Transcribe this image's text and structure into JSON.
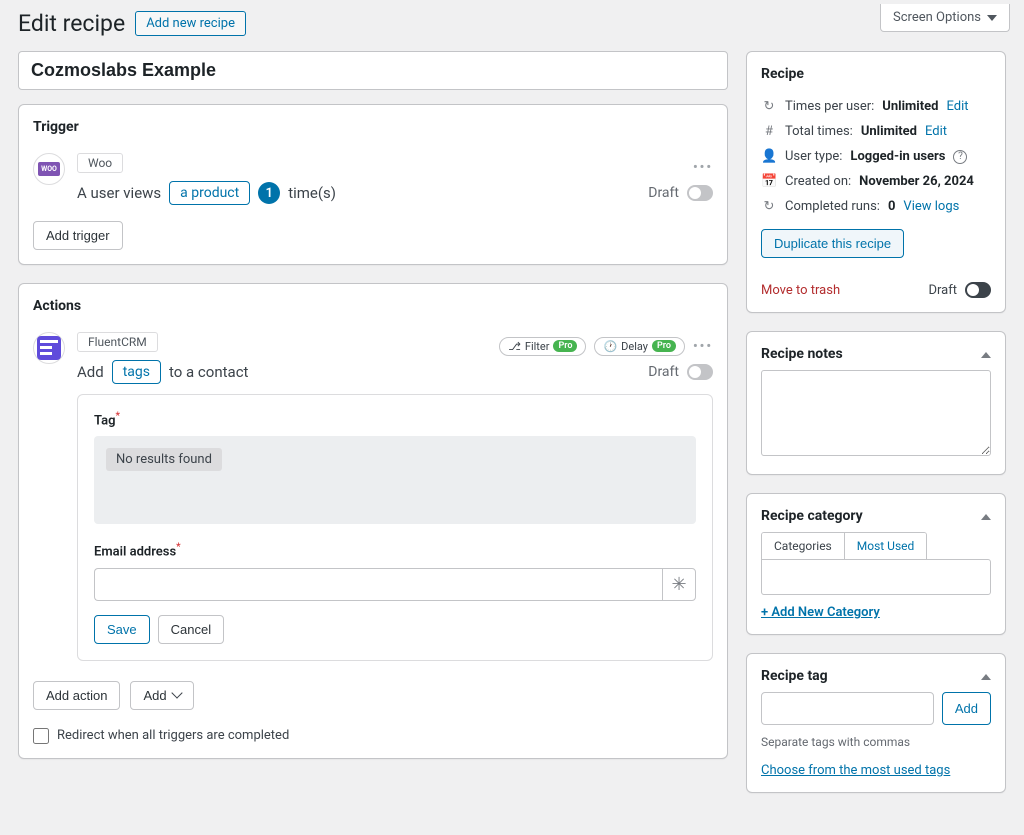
{
  "screen_options": "Screen Options",
  "page": {
    "title": "Edit recipe",
    "add_new": "Add new recipe"
  },
  "recipe": {
    "title": "Cozmoslabs Example"
  },
  "trigger_box": {
    "heading": "Trigger",
    "integration": "Woo",
    "sentence_pre": "A user views",
    "token": "a product",
    "count": "1",
    "sentence_post": "time(s)",
    "status": "Draft",
    "add_btn": "Add trigger"
  },
  "actions_box": {
    "heading": "Actions",
    "integration": "FluentCRM",
    "filter_label": "Filter",
    "delay_label": "Delay",
    "pro": "Pro",
    "sentence_pre": "Add",
    "token": "tags",
    "sentence_post": "to a contact",
    "status": "Draft",
    "form": {
      "tag_label": "Tag",
      "tag_no_results": "No results found",
      "email_label": "Email address",
      "save": "Save",
      "cancel": "Cancel"
    },
    "add_action": "Add action",
    "add": "Add",
    "redirect": "Redirect when all triggers are completed"
  },
  "sidebar": {
    "recipe": {
      "heading": "Recipe",
      "times_per_user_label": "Times per user:",
      "times_per_user_value": "Unlimited",
      "total_times_label": "Total times:",
      "total_times_value": "Unlimited",
      "user_type_label": "User type:",
      "user_type_value": "Logged-in users",
      "created_label": "Created on:",
      "created_value": "November 26, 2024",
      "completed_label": "Completed runs:",
      "completed_value": "0",
      "edit": "Edit",
      "view_logs": "View logs",
      "duplicate": "Duplicate this recipe",
      "trash": "Move to trash",
      "status": "Draft"
    },
    "notes": {
      "heading": "Recipe notes"
    },
    "category": {
      "heading": "Recipe category",
      "tab_cat": "Categories",
      "tab_most": "Most Used",
      "add_new": "+ Add New Category"
    },
    "tag": {
      "heading": "Recipe tag",
      "add": "Add",
      "helper": "Separate tags with commas",
      "choose": "Choose from the most used tags"
    }
  }
}
